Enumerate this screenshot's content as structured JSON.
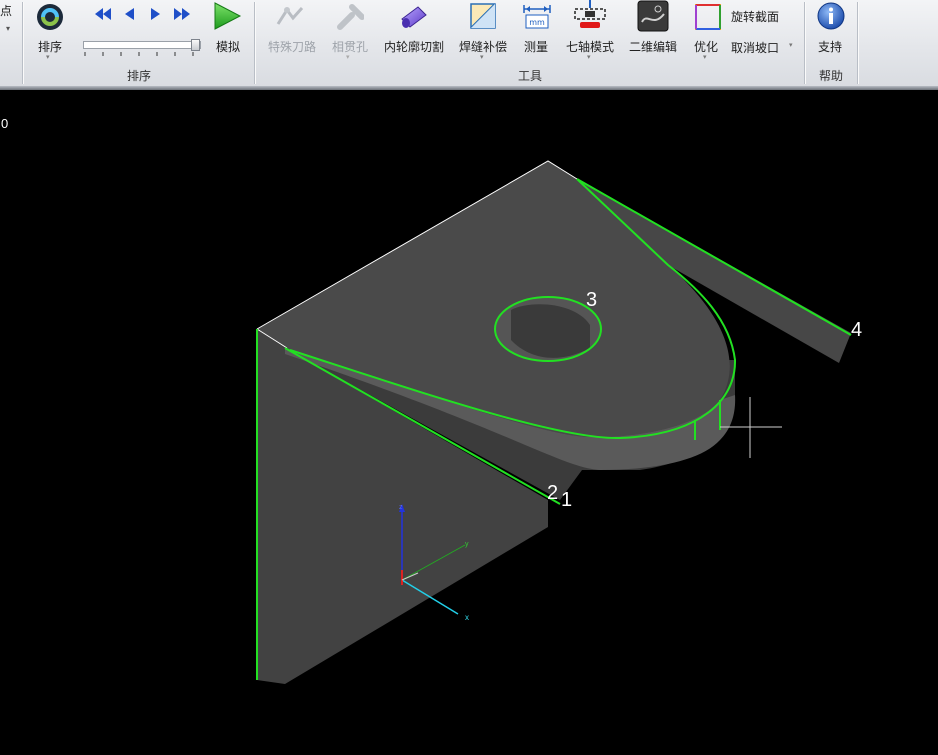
{
  "ribbon": {
    "left_cut_label": "点",
    "groups": {
      "sort": "排序",
      "tools": "工具",
      "help": "帮助"
    },
    "sort": {
      "sort_label": "排序",
      "simulate_label": "模拟",
      "progress_fraction": 0.98
    },
    "tools": {
      "special_path": "特殊刀路",
      "phase_hole": "相贯孔",
      "inner_contour_cut": "内轮廓切割",
      "weld_compensation": "焊缝补偿",
      "measure": "测量",
      "seven_axis": "七轴模式",
      "edit_2d": "二维编辑",
      "optimize": "优化",
      "rotate_section": "旋转截面",
      "cancel_bevel": "取消坡口",
      "mm_text": "mm"
    },
    "help": {
      "support": "支持"
    }
  },
  "viewport": {
    "corner_label": "0",
    "path_labels": [
      "1",
      "2",
      "3",
      "4"
    ],
    "axis_labels": {
      "x": "x",
      "y": "y",
      "z": "z"
    },
    "colors": {
      "path": "#22e022",
      "face": "#474747",
      "edge": "#ffffff"
    }
  }
}
